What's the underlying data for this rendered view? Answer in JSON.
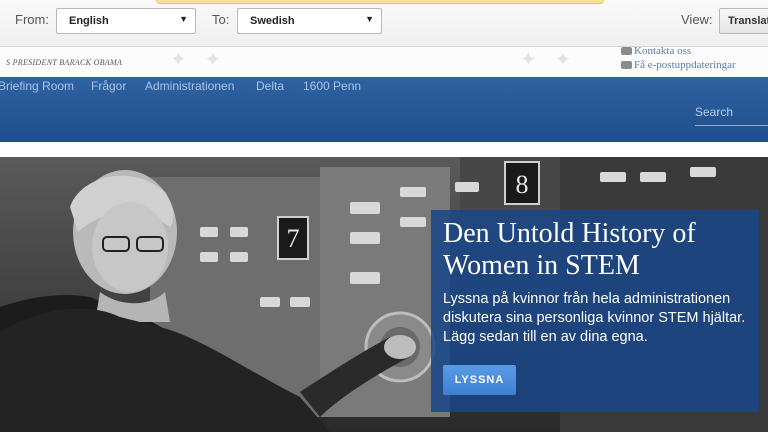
{
  "translate_bar": {
    "from_label": "From:",
    "from_value": "English",
    "to_label": "To:",
    "to_value": "Swedish",
    "view_label": "View:",
    "view_value": "Translat"
  },
  "header": {
    "tagline": "S PRESIDENT BARACK OBAMA",
    "contact_link": "Kontakta oss",
    "email_link": "Få e-postuppdateringar"
  },
  "nav": {
    "items": [
      "Briefing Room",
      "Frågor",
      "Administrationen",
      "Delta",
      "1600 Penn"
    ],
    "search_placeholder": "Search"
  },
  "hero": {
    "image": "black-and-white photo of a woman operating a computer",
    "panel_numbers": [
      "7",
      "8"
    ],
    "title": "Den Untold History of Women in STEM",
    "description": "Lyssna på kvinnor från hela administrationen diskutera sina personliga kvinnor STEM hjältar. Lägg sedan till en av dina egna.",
    "button": "LYSSNA"
  },
  "colors": {
    "nav_blue": "#2a5b9a",
    "feature_blue": "#1a4a8a",
    "button_blue": "#4a8ddf"
  }
}
